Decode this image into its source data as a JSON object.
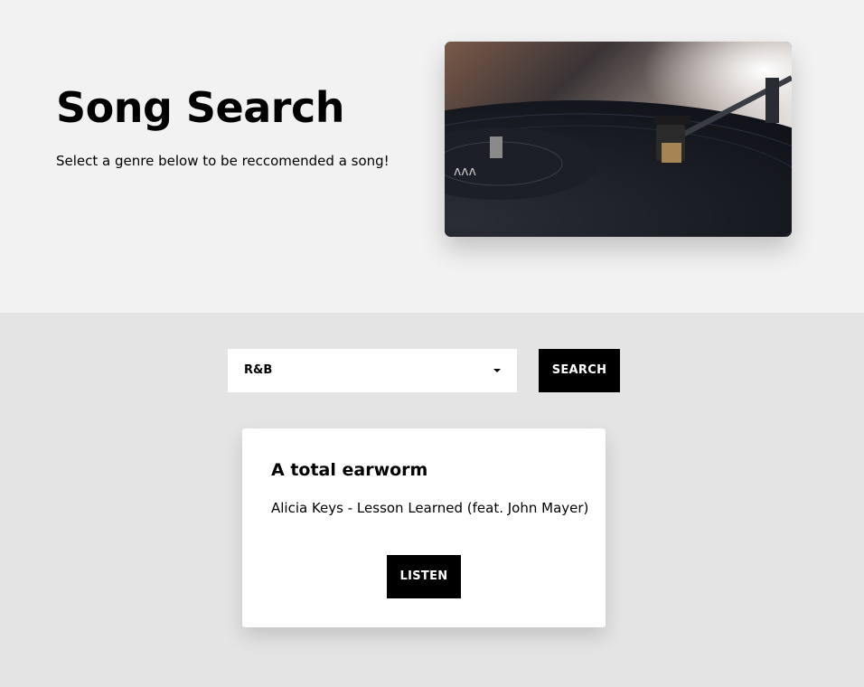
{
  "hero": {
    "title": "Song Search",
    "subtitle": "Select a genre below to be reccomended a song!",
    "image": "turntable-photo"
  },
  "search": {
    "selected_genre": "R&B",
    "button_label": "SEARCH"
  },
  "result": {
    "heading": "A total earworm",
    "song": "Alicia Keys - Lesson Learned (feat. John Mayer)",
    "listen_label": "LISTEN"
  },
  "colors": {
    "hero_bg": "#f2f2f2",
    "lower_bg": "#e4e4e4",
    "button_bg": "#000000",
    "card_bg": "#ffffff"
  }
}
